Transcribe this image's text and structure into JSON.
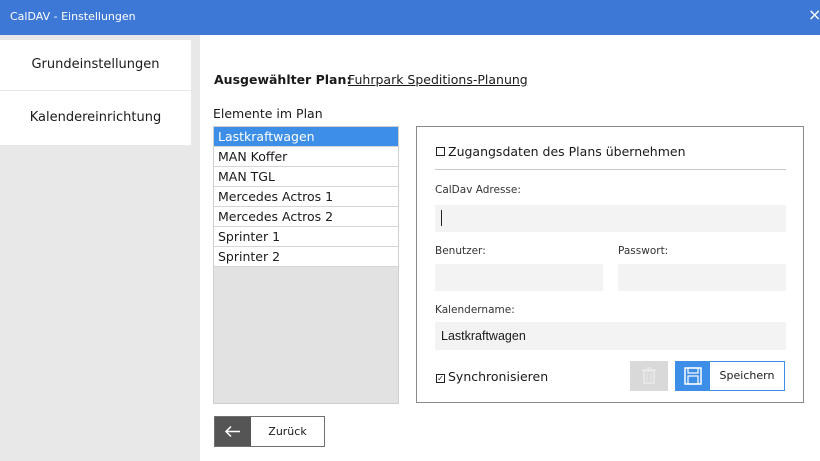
{
  "window": {
    "title": "CalDAV - Einstellungen",
    "close_glyph": "×"
  },
  "sidebar": {
    "items": [
      {
        "label": "Grundeinstellungen"
      },
      {
        "label": "Kalendereinrichtung"
      }
    ]
  },
  "plan": {
    "label": "Ausgewählter Plan:",
    "name": "Fuhrpark Speditions-Planung"
  },
  "elements": {
    "label": "Elemente im Plan",
    "items": [
      "Lastkraftwagen",
      "MAN Koffer",
      "MAN TGL",
      "Mercedes Actros 1",
      "Mercedes Actros 2",
      "Sprinter 1",
      "Sprinter 2"
    ],
    "selected": "Lastkraftwagen"
  },
  "form": {
    "use_plan_credentials": {
      "label": "Zugangsdaten des Plans übernehmen",
      "checked": false
    },
    "caldav_address": {
      "label": "CalDav Adresse:",
      "value": ""
    },
    "user": {
      "label": "Benutzer:",
      "value": ""
    },
    "password": {
      "label": "Passwort:",
      "value": ""
    },
    "calendar_name": {
      "label": "Kalendername:",
      "value": "Lastkraftwagen"
    },
    "synchronize": {
      "label": "Synchronisieren",
      "checked": true
    },
    "save_label": "Speichern"
  },
  "footer": {
    "back_label": "Zurück"
  },
  "colors": {
    "titlebar": "#3e78d6",
    "accent": "#3c8ee6"
  }
}
